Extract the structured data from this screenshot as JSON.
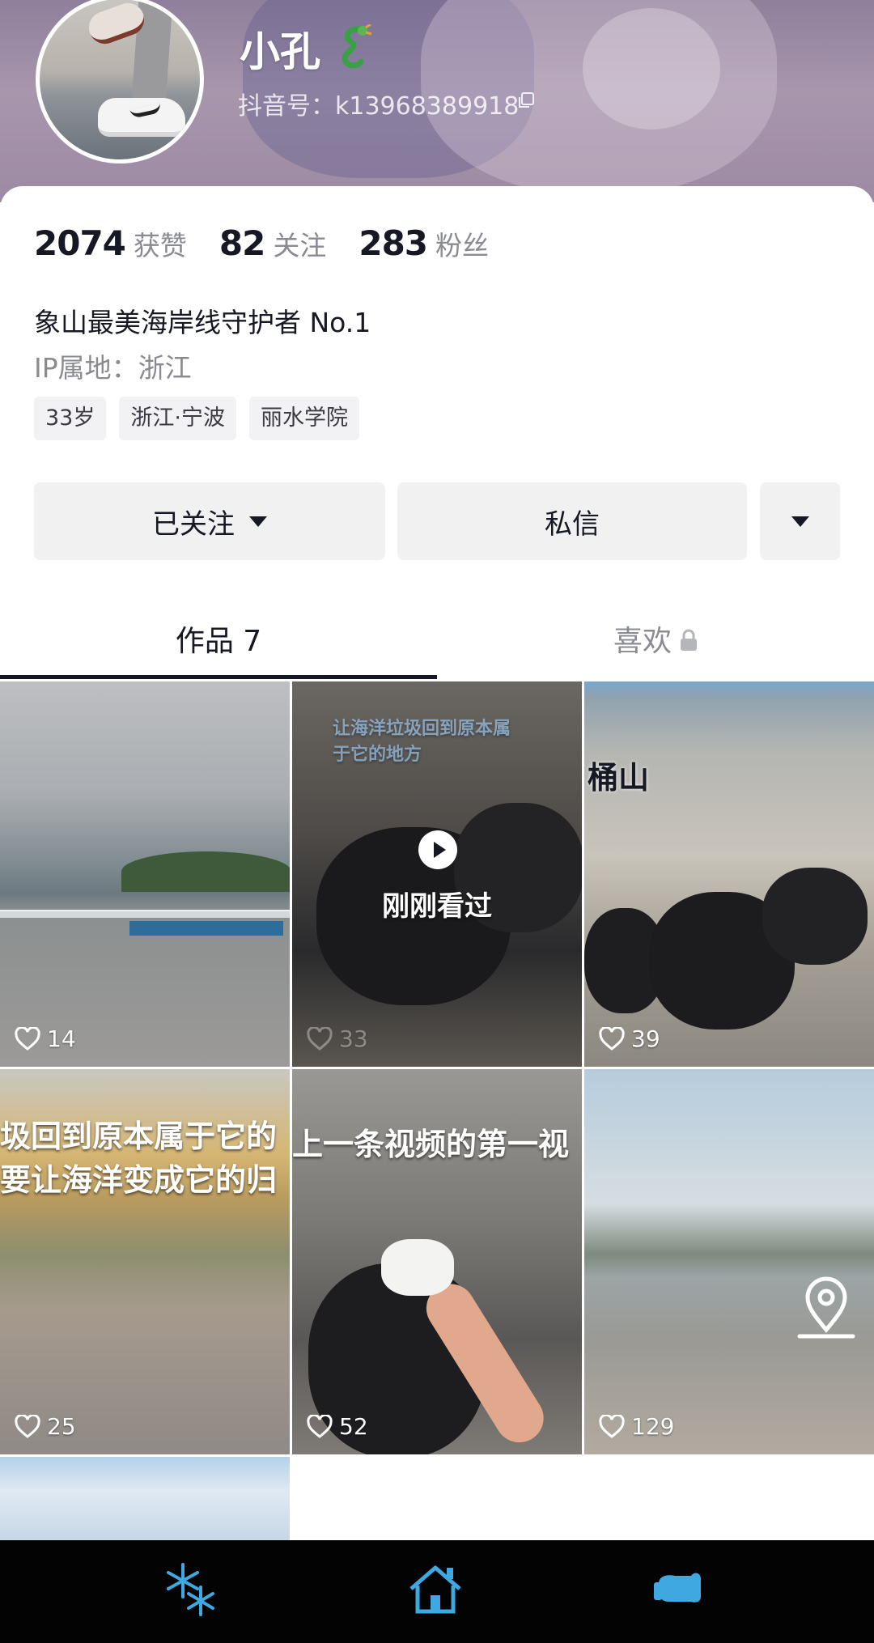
{
  "profile": {
    "username": "小孔",
    "douyin_id_label": "抖音号：k13968389918",
    "bio": "象山最美海岸线守护者 No.1",
    "ip_location": "IP属地：浙江"
  },
  "stats": [
    {
      "value": "2074",
      "label": "获赞"
    },
    {
      "value": "82",
      "label": "关注"
    },
    {
      "value": "283",
      "label": "粉丝"
    }
  ],
  "tags": [
    "33岁",
    "浙江·宁波",
    "丽水学院"
  ],
  "actions": {
    "follow_label": "已关注",
    "message_label": "私信"
  },
  "tabs": {
    "works_label": "作品 7",
    "likes_label": "喜欢"
  },
  "videos": [
    {
      "likes": "14"
    },
    {
      "likes": "33",
      "watched_label": "刚刚看过",
      "overlay": "让海洋垃圾回到原本属于它的地方"
    },
    {
      "likes": "39",
      "overlay": "桶山"
    },
    {
      "likes": "25",
      "overlay_line1": "圾回到原本属于它的",
      "overlay_line2": "要让海洋变成它的归"
    },
    {
      "likes": "52",
      "overlay": "上一条视频的第一视"
    },
    {
      "likes": "129"
    },
    {}
  ],
  "bottom_nav": {
    "icons": [
      "snowflake-icon",
      "home-icon",
      "glove-icon"
    ]
  },
  "colors": {
    "accent_dark": "#161823",
    "muted_text": "#8a8b91",
    "button_bg": "#f1f1f2",
    "nav_glow": "#3fa8e0"
  }
}
